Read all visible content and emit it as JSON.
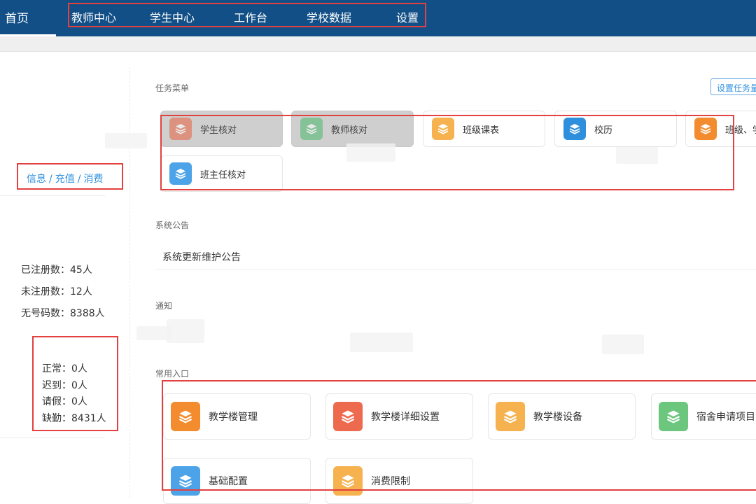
{
  "nav": {
    "home": "首页",
    "items": [
      "教师中心",
      "学生中心",
      "工作台",
      "学校数据",
      "设置"
    ]
  },
  "left": {
    "links": [
      "信息",
      "充值",
      "消费"
    ],
    "registration": {
      "registered": "已注册数：45人",
      "unregistered": "未注册数：12人",
      "no_number": "无号码数：8388人"
    },
    "attendance": {
      "normal": "正常：0人",
      "late": "迟到：0人",
      "leave": "请假：0人",
      "absent": "缺勤：8431人"
    }
  },
  "tasks": {
    "title": "任务菜单",
    "config_button": "设置任务量",
    "items": [
      {
        "label": "学生核对",
        "color": "#e8623f"
      },
      {
        "label": "教师核对",
        "color": "#4cb96b"
      },
      {
        "label": "班级课表",
        "color": "#f5b24f"
      },
      {
        "label": "校历",
        "color": "#2e8fdc"
      },
      {
        "label": "班级、学",
        "color": "#f28c2e"
      },
      {
        "label": "班主任核对",
        "color": "#4da3e8"
      }
    ]
  },
  "announcement": {
    "title": "系统公告",
    "item": "系统更新维护公告"
  },
  "notification": {
    "title": "通知"
  },
  "entries": {
    "title": "常用入口",
    "items": [
      {
        "label": "教学楼管理",
        "color": "#f28c2e"
      },
      {
        "label": "教学楼详细设置",
        "color": "#ee6a4f"
      },
      {
        "label": "教学楼设备",
        "color": "#f5b24f"
      },
      {
        "label": "宿舍申请项目",
        "color": "#6cc67d"
      },
      {
        "label": "基础配置",
        "color": "#4da3e8"
      },
      {
        "label": "消费限制",
        "color": "#f5b24f"
      }
    ]
  }
}
